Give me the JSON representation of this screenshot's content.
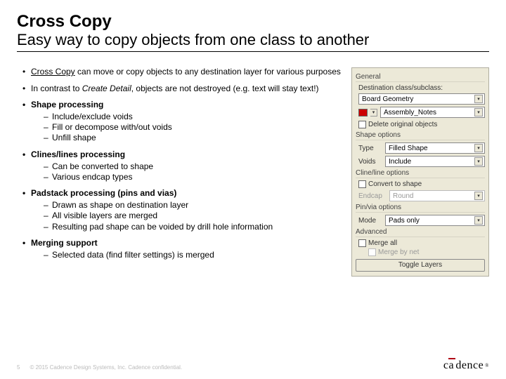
{
  "title": "Cross Copy",
  "subtitle": "Easy way to copy objects from one class to another",
  "bullets": {
    "b1a": "Cross Copy",
    "b1b": " can move or copy objects to any destination layer for various purposes",
    "b2a": "In contrast to ",
    "b2b": "Create Detail",
    "b2c": ", objects are not destroyed (e.g. text will stay text!)",
    "b3": "Shape processing",
    "b3s": [
      "Include/exclude voids",
      "Fill or decompose with/out voids",
      "Unfill shape"
    ],
    "b4": "Clines/lines processing",
    "b4s": [
      "Can be converted to shape",
      "Various endcap types"
    ],
    "b5": "Padstack processing (pins and vias)",
    "b5s": [
      "Drawn as shape on destination layer",
      "All visible layers are merged",
      "Resulting pad shape can be voided by drill hole information"
    ],
    "b6": "Merging support",
    "b6s": [
      "Selected data (find filter settings) is merged"
    ]
  },
  "panel": {
    "general": {
      "title": "General",
      "dest_label": "Destination class/subclass:",
      "class_val": "Board Geometry",
      "subclass_val": "Assembly_Notes",
      "delete_label": "Delete original objects"
    },
    "shape": {
      "title": "Shape options",
      "type_label": "Type",
      "type_val": "Filled Shape",
      "voids_label": "Voids",
      "voids_val": "Include"
    },
    "cline": {
      "title": "Cline/line options",
      "convert_label": "Convert to shape",
      "endcap_label": "Endcap",
      "endcap_val": "Round"
    },
    "pin": {
      "title": "Pin/via options",
      "mode_label": "Mode",
      "mode_val": "Pads only"
    },
    "adv": {
      "title": "Advanced",
      "merge_all": "Merge all",
      "merge_net": "Merge by net",
      "toggle_btn": "Toggle Layers"
    }
  },
  "footer": {
    "page": "5",
    "copyright": "© 2015 Cadence Design Systems, Inc. Cadence confidential."
  },
  "logo": {
    "pre": "c",
    "post": "dence",
    "reg": "®"
  }
}
